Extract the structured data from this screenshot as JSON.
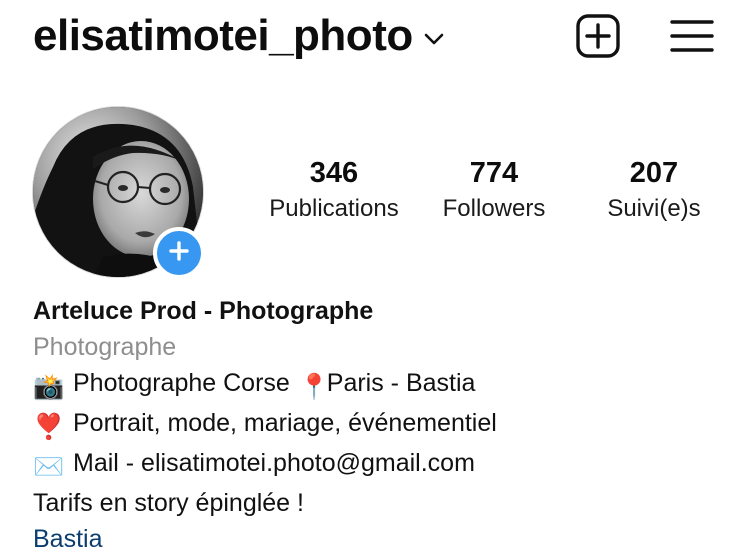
{
  "header": {
    "username": "elisatimotei_photo",
    "username_chevron_icon": "chevron-down-icon",
    "new_post_icon": "plus-square-icon",
    "menu_icon": "hamburger-menu-icon"
  },
  "profile": {
    "avatar_alt": "profile-photo",
    "add_story_icon": "plus-icon",
    "accent_color": "#3897f0"
  },
  "stats": {
    "posts": {
      "count": "346",
      "label": "Publications"
    },
    "followers": {
      "count": "774",
      "label": "Followers"
    },
    "following": {
      "count": "207",
      "label": "Suivi(e)s"
    }
  },
  "bio": {
    "name": "Arteluce Prod - Photographe",
    "category": "Photographe",
    "lines": [
      {
        "emoji": "📸",
        "icon": "camera-flash-icon",
        "text": "Photographe Corse",
        "extra_emoji": "📍",
        "extra_icon": "round-pushpin-icon",
        "extra_text": "Paris - Bastia"
      },
      {
        "emoji": "❣️",
        "icon": "heart-exclamation-icon",
        "text": "Portrait, mode, mariage, événementiel"
      },
      {
        "emoji": "✉️",
        "icon": "envelope-icon",
        "text": "Mail - elisatimotei.photo@gmail.com"
      }
    ],
    "tagline": "Tarifs en story épinglée !",
    "location_link": "Bastia"
  }
}
